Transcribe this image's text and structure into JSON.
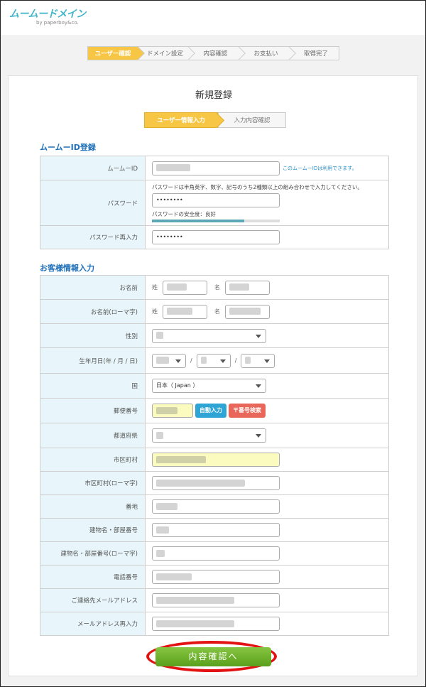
{
  "header": {
    "logo_text": "ムームードメイン",
    "logo_sub": "by paperboy&co."
  },
  "steps": [
    "ユーザー確認",
    "ドメイン設定",
    "内容確認",
    "お支払い",
    "取得完了"
  ],
  "panel": {
    "title": "新規登録",
    "substeps": [
      "ユーザー情報入力",
      "入力内容確認"
    ]
  },
  "section_id": {
    "title": "ムームーID登録",
    "muumuu_id_label": "ムームーID",
    "muumuu_id_hint": "このムームーIDは利用できます。",
    "password_label": "パスワード",
    "password_note": "パスワードは半角英字、数字、記号のうち2種類以上の組み合わせで入力してください。",
    "password_value": "••••••••",
    "password_strength": "パスワードの安全度：良好",
    "password_strength_level": 0.72,
    "password_confirm_label": "パスワード再入力",
    "password_confirm_value": "••••••••"
  },
  "section_customer": {
    "title": "お客様情報入力",
    "name_label": "お名前",
    "name_romaji_label": "お名前(ローマ字)",
    "sei": "姓",
    "mei": "名",
    "gender_label": "性別",
    "birthdate_label": "生年月日(年 / 月 / 日)",
    "date_sep": "/",
    "country_label": "国",
    "country_value": "日本（ Japan ）",
    "postal_label": "郵便番号",
    "auto_fill_button": "自動入力",
    "postal_search_button": "〒番号検索",
    "prefecture_label": "都道府県",
    "city_label": "市区町村",
    "city_romaji_label": "市区町村(ローマ字)",
    "street_label": "番地",
    "building_label": "建物名・部屋番号",
    "building_romaji_label": "建物名・部屋番号(ローマ字)",
    "phone_label": "電話番号",
    "email_label": "ご連絡先メールアドレス",
    "email_confirm_label": "メールアドレス再入力"
  },
  "submit_label": "内容確認へ",
  "colors": {
    "accent_yellow": "#f8c645",
    "label_bg": "#e8f6fb",
    "submit_green": "#6cb32a",
    "highlight_red": "#e31212",
    "section_blue": "#1e6fb8"
  }
}
